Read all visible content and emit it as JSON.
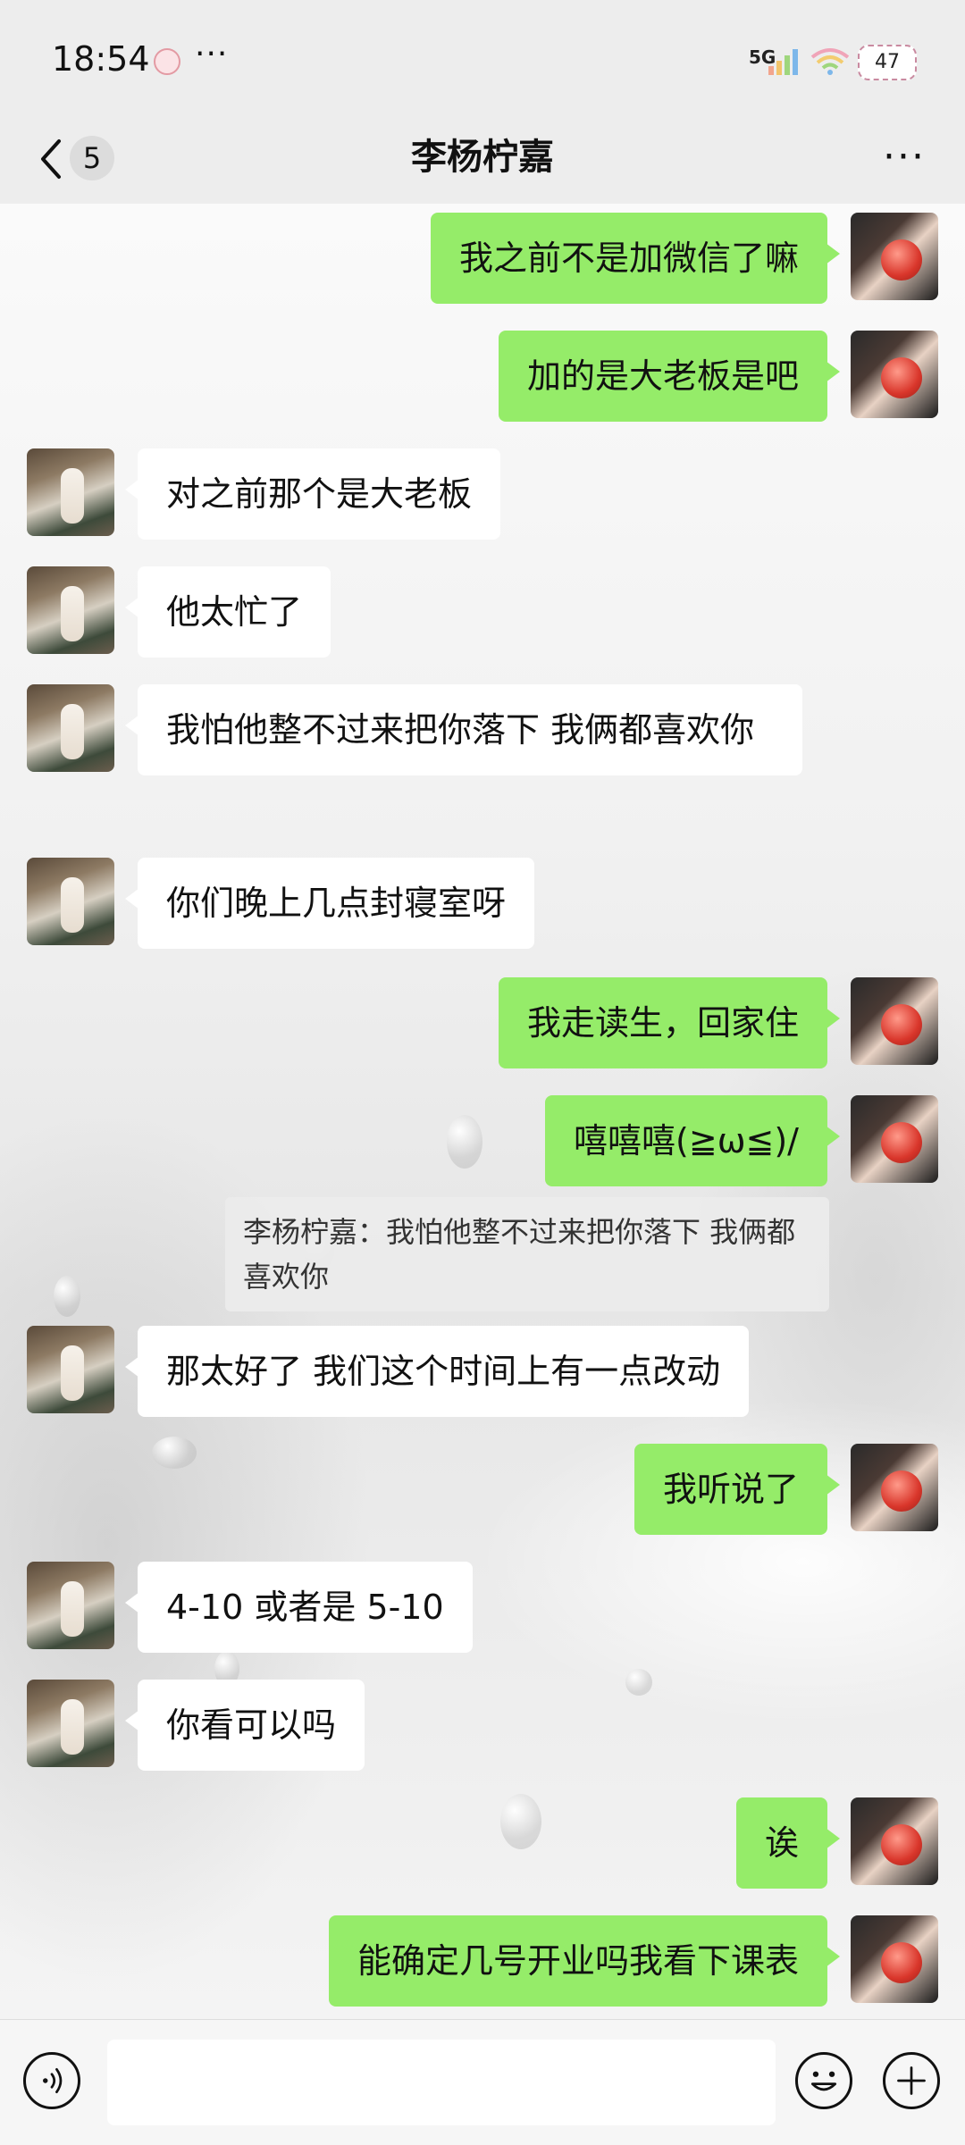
{
  "status_bar": {
    "time": "18:54",
    "more": "···",
    "network": "5G",
    "battery": "47"
  },
  "nav": {
    "back_badge": "5",
    "title": "李杨柠嘉",
    "more": "···"
  },
  "messages": [
    {
      "from": "me",
      "text": "我之前不是加微信了嘛"
    },
    {
      "from": "me",
      "text": "加的是大老板是吧"
    },
    {
      "from": "other",
      "text": "对之前那个是大老板"
    },
    {
      "from": "other",
      "text": "他太忙了"
    },
    {
      "from": "other",
      "text": "我怕他整不过来把你落下 我俩都喜欢你"
    },
    {
      "from": "other",
      "text": "你们晚上几点封寝室呀"
    },
    {
      "from": "me",
      "text": "我走读生，回家住"
    },
    {
      "from": "me",
      "text": "嘻嘻嘻(≧ω≦)/"
    },
    {
      "from": "quote",
      "text": "李杨柠嘉：我怕他整不过来把你落下 我俩都喜欢你"
    },
    {
      "from": "other",
      "text": "那太好了 我们这个时间上有一点改动"
    },
    {
      "from": "me",
      "text": "我听说了"
    },
    {
      "from": "other",
      "text": "4-10 或者是 5-10"
    },
    {
      "from": "other",
      "text": "你看可以吗"
    },
    {
      "from": "me",
      "text": "诶"
    },
    {
      "from": "me",
      "text": "能确定几号开业吗我看下课表"
    }
  ],
  "colors": {
    "my_bubble": "#95ec69",
    "other_bubble": "#ffffff",
    "bar_bg": "#ededed"
  },
  "icons": {
    "back": "chevron-left-icon",
    "voice": "voice-icon",
    "emoji": "emoji-icon",
    "plus": "plus-icon"
  }
}
